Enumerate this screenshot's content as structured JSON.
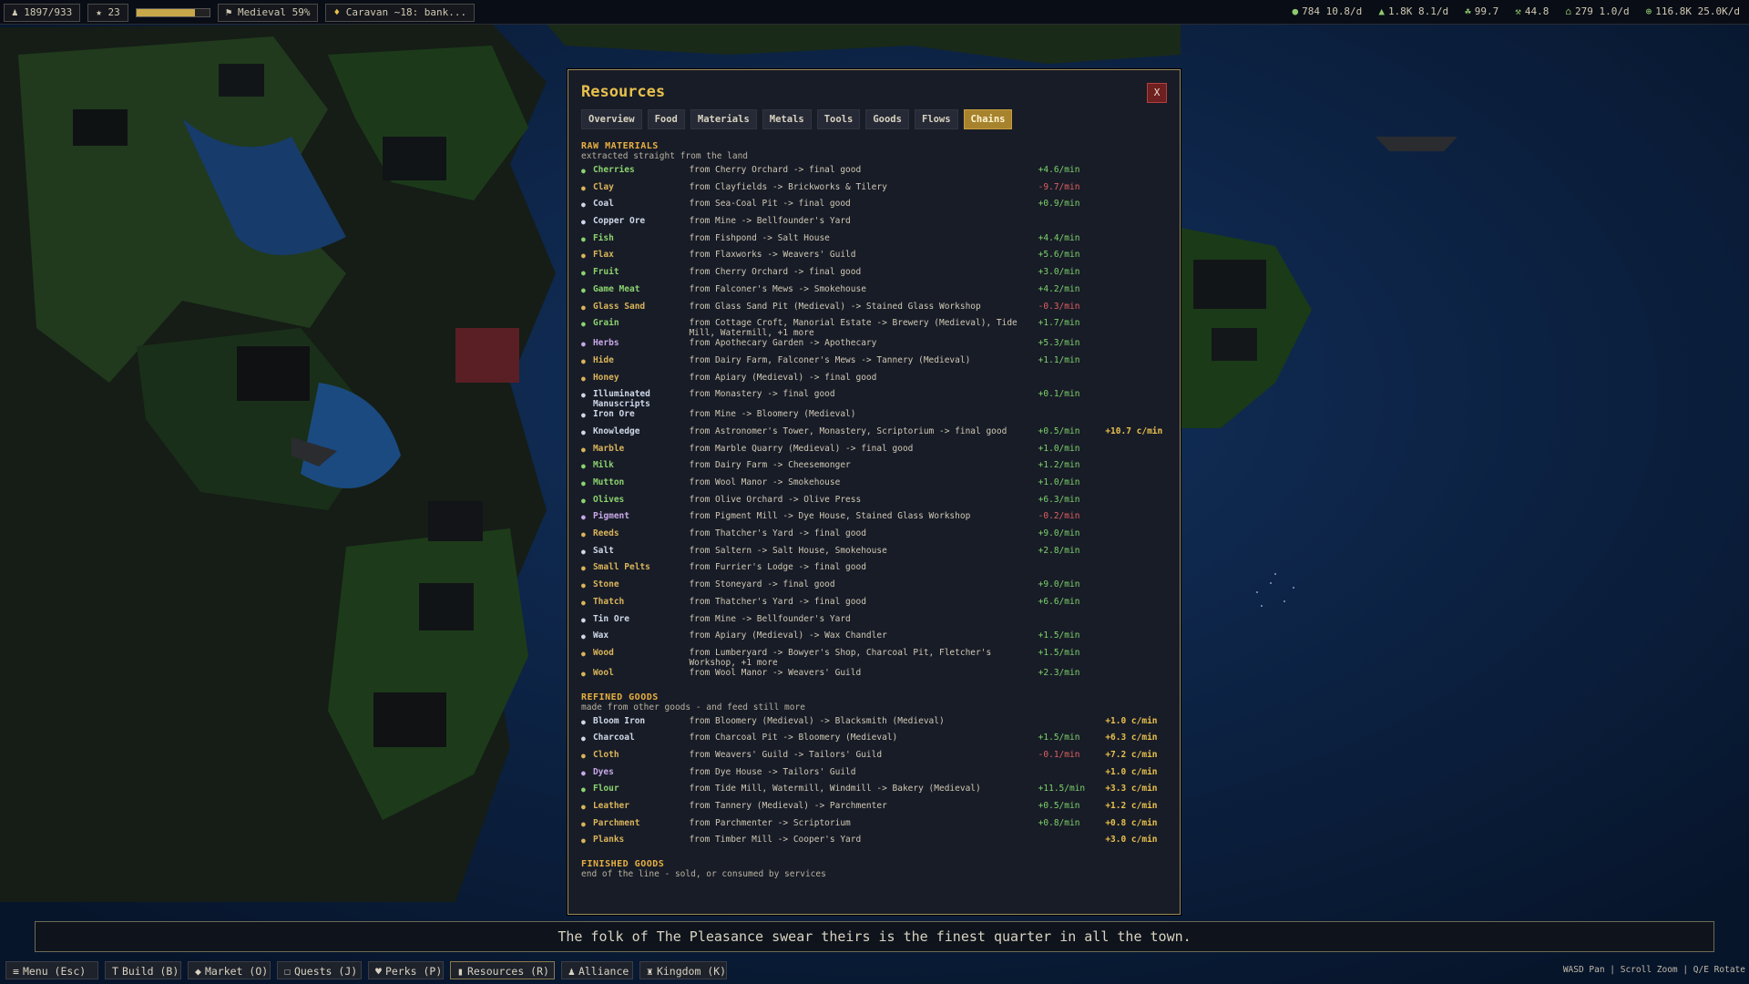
{
  "hud": {
    "population": "1897/933",
    "stars": "23",
    "era_progress": 0.8,
    "era": "Medieval 59%",
    "caravan": "Caravan ~18: bank...",
    "stats": [
      {
        "icon": "●",
        "value": "784 10.8/d"
      },
      {
        "icon": "▲",
        "value": "1.8K 8.1/d"
      },
      {
        "icon": "☘",
        "value": "99.7"
      },
      {
        "icon": "⚒",
        "value": "44.8"
      },
      {
        "icon": "⌂",
        "value": "279 1.0/d"
      },
      {
        "icon": "⊕",
        "value": "116.8K 25.0K/d"
      }
    ]
  },
  "panel": {
    "title": "Resources",
    "close_label": "X",
    "tabs": [
      "Overview",
      "Food",
      "Materials",
      "Metals",
      "Tools",
      "Goods",
      "Flows",
      "Chains"
    ],
    "active_tab": 7,
    "sections": {
      "raw": {
        "title": "RAW MATERIALS",
        "subtitle": "extracted straight from the land",
        "items": [
          {
            "icon": "●",
            "cls": "g",
            "name": "Cherries",
            "src": "from Cherry Orchard   -> final good",
            "rate": "+4.6/min",
            "rcls": "pos",
            "cmin": ""
          },
          {
            "icon": "●",
            "cls": "y",
            "name": "Clay",
            "src": "from Clayfields   -> Brickworks & Tilery",
            "rate": "-9.7/min",
            "rcls": "neg",
            "cmin": ""
          },
          {
            "icon": "●",
            "cls": "w",
            "name": "Coal",
            "src": "from Sea-Coal Pit   -> final good",
            "rate": "+0.9/min",
            "rcls": "pos",
            "cmin": ""
          },
          {
            "icon": "●",
            "cls": "w",
            "name": "Copper Ore",
            "src": "from Mine   -> Bellfounder's Yard",
            "rate": "",
            "rcls": "pos",
            "cmin": ""
          },
          {
            "icon": "●",
            "cls": "g",
            "name": "Fish",
            "src": "from Fishpond   -> Salt House",
            "rate": "+4.4/min",
            "rcls": "pos",
            "cmin": ""
          },
          {
            "icon": "●",
            "cls": "y",
            "name": "Flax",
            "src": "from Flaxworks   -> Weavers' Guild",
            "rate": "+5.6/min",
            "rcls": "pos",
            "cmin": ""
          },
          {
            "icon": "●",
            "cls": "g",
            "name": "Fruit",
            "src": "from Cherry Orchard   -> final good",
            "rate": "+3.0/min",
            "rcls": "pos",
            "cmin": ""
          },
          {
            "icon": "●",
            "cls": "g",
            "name": "Game Meat",
            "src": "from Falconer's Mews   -> Smokehouse",
            "rate": "+4.2/min",
            "rcls": "pos",
            "cmin": ""
          },
          {
            "icon": "●",
            "cls": "y",
            "name": "Glass Sand",
            "src": "from Glass Sand Pit (Medieval)   -> Stained Glass Workshop",
            "rate": "-0.3/min",
            "rcls": "neg",
            "cmin": ""
          },
          {
            "icon": "●",
            "cls": "g",
            "name": "Grain",
            "src": "from Cottage Croft, Manorial Estate   -> Brewery (Medieval), Tide Mill, Watermill, +1 more",
            "rate": "+1.7/min",
            "rcls": "pos",
            "cmin": ""
          },
          {
            "icon": "●",
            "cls": "p",
            "name": "Herbs",
            "src": "from Apothecary Garden   -> Apothecary",
            "rate": "+5.3/min",
            "rcls": "pos",
            "cmin": ""
          },
          {
            "icon": "●",
            "cls": "y",
            "name": "Hide",
            "src": "from Dairy Farm, Falconer's Mews   -> Tannery (Medieval)",
            "rate": "+1.1/min",
            "rcls": "pos",
            "cmin": ""
          },
          {
            "icon": "●",
            "cls": "y",
            "name": "Honey",
            "src": "from Apiary (Medieval)   -> final good",
            "rate": "",
            "rcls": "pos",
            "cmin": ""
          },
          {
            "icon": "●",
            "cls": "w",
            "name": "Illuminated Manuscripts",
            "src": "from Monastery   -> final good",
            "rate": "+0.1/min",
            "rcls": "pos",
            "cmin": ""
          },
          {
            "icon": "●",
            "cls": "w",
            "name": "Iron Ore",
            "src": "from Mine   -> Bloomery (Medieval)",
            "rate": "",
            "rcls": "pos",
            "cmin": ""
          },
          {
            "icon": "●",
            "cls": "w",
            "name": "Knowledge",
            "src": "from Astronomer's Tower, Monastery, Scriptorium   -> final good",
            "rate": "+0.5/min",
            "rcls": "pos",
            "cmin": "+10.7 c/min"
          },
          {
            "icon": "●",
            "cls": "y",
            "name": "Marble",
            "src": "from Marble Quarry (Medieval)   -> final good",
            "rate": "+1.0/min",
            "rcls": "pos",
            "cmin": ""
          },
          {
            "icon": "●",
            "cls": "g",
            "name": "Milk",
            "src": "from Dairy Farm   -> Cheesemonger",
            "rate": "+1.2/min",
            "rcls": "pos",
            "cmin": ""
          },
          {
            "icon": "●",
            "cls": "g",
            "name": "Mutton",
            "src": "from Wool Manor   -> Smokehouse",
            "rate": "+1.0/min",
            "rcls": "pos",
            "cmin": ""
          },
          {
            "icon": "●",
            "cls": "g",
            "name": "Olives",
            "src": "from Olive Orchard   -> Olive Press",
            "rate": "+6.3/min",
            "rcls": "pos",
            "cmin": ""
          },
          {
            "icon": "●",
            "cls": "p",
            "name": "Pigment",
            "src": "from Pigment Mill   -> Dye House, Stained Glass Workshop",
            "rate": "-0.2/min",
            "rcls": "neg",
            "cmin": ""
          },
          {
            "icon": "●",
            "cls": "y",
            "name": "Reeds",
            "src": "from Thatcher's Yard   -> final good",
            "rate": "+9.0/min",
            "rcls": "pos",
            "cmin": ""
          },
          {
            "icon": "●",
            "cls": "w",
            "name": "Salt",
            "src": "from Saltern   -> Salt House, Smokehouse",
            "rate": "+2.8/min",
            "rcls": "pos",
            "cmin": ""
          },
          {
            "icon": "●",
            "cls": "y",
            "name": "Small Pelts",
            "src": "from Furrier's Lodge   -> final good",
            "rate": "",
            "rcls": "pos",
            "cmin": ""
          },
          {
            "icon": "●",
            "cls": "y",
            "name": "Stone",
            "src": "from Stoneyard   -> final good",
            "rate": "+9.0/min",
            "rcls": "pos",
            "cmin": ""
          },
          {
            "icon": "●",
            "cls": "y",
            "name": "Thatch",
            "src": "from Thatcher's Yard   -> final good",
            "rate": "+6.6/min",
            "rcls": "pos",
            "cmin": ""
          },
          {
            "icon": "●",
            "cls": "w",
            "name": "Tin Ore",
            "src": "from Mine   -> Bellfounder's Yard",
            "rate": "",
            "rcls": "pos",
            "cmin": ""
          },
          {
            "icon": "●",
            "cls": "w",
            "name": "Wax",
            "src": "from Apiary (Medieval)   -> Wax Chandler",
            "rate": "+1.5/min",
            "rcls": "pos",
            "cmin": ""
          },
          {
            "icon": "●",
            "cls": "y",
            "name": "Wood",
            "src": "from Lumberyard   -> Bowyer's Shop, Charcoal Pit, Fletcher's Workshop, +1 more",
            "rate": "+1.5/min",
            "rcls": "pos",
            "cmin": ""
          },
          {
            "icon": "●",
            "cls": "y",
            "name": "Wool",
            "src": "from Wool Manor   -> Weavers' Guild",
            "rate": "+2.3/min",
            "rcls": "pos",
            "cmin": ""
          }
        ]
      },
      "refined": {
        "title": "REFINED GOODS",
        "subtitle": "made from other goods - and feed still more",
        "items": [
          {
            "icon": "●",
            "cls": "w",
            "name": "Bloom Iron",
            "src": "from Bloomery (Medieval)   -> Blacksmith (Medieval)",
            "rate": "",
            "rcls": "pos",
            "cmin": "+1.0 c/min"
          },
          {
            "icon": "●",
            "cls": "w",
            "name": "Charcoal",
            "src": "from Charcoal Pit   -> Bloomery (Medieval)",
            "rate": "+1.5/min",
            "rcls": "pos",
            "cmin": "+6.3 c/min"
          },
          {
            "icon": "●",
            "cls": "y",
            "name": "Cloth",
            "src": "from Weavers' Guild   -> Tailors' Guild",
            "rate": "-0.1/min",
            "rcls": "neg",
            "cmin": "+7.2 c/min"
          },
          {
            "icon": "●",
            "cls": "p",
            "name": "Dyes",
            "src": "from Dye House   -> Tailors' Guild",
            "rate": "",
            "rcls": "pos",
            "cmin": "+1.0 c/min"
          },
          {
            "icon": "●",
            "cls": "g",
            "name": "Flour",
            "src": "from Tide Mill, Watermill, Windmill   -> Bakery (Medieval)",
            "rate": "+11.5/min",
            "rcls": "pos",
            "cmin": "+3.3 c/min"
          },
          {
            "icon": "●",
            "cls": "y",
            "name": "Leather",
            "src": "from Tannery (Medieval)   -> Parchmenter",
            "rate": "+0.5/min",
            "rcls": "pos",
            "cmin": "+1.2 c/min"
          },
          {
            "icon": "●",
            "cls": "y",
            "name": "Parchment",
            "src": "from Parchmenter   -> Scriptorium",
            "rate": "+0.8/min",
            "rcls": "pos",
            "cmin": "+0.8 c/min"
          },
          {
            "icon": "●",
            "cls": "y",
            "name": "Planks",
            "src": "from Timber Mill   -> Cooper's Yard",
            "rate": "",
            "rcls": "pos",
            "cmin": "+3.0 c/min"
          }
        ]
      },
      "finished": {
        "title": "FINISHED GOODS",
        "subtitle": "end of the line - sold, or consumed by services",
        "items": []
      }
    }
  },
  "message": "The folk of The Pleasance swear theirs is the finest quarter in all the town.",
  "bottom": {
    "buttons": [
      {
        "icon": "≡",
        "label": "Menu (Esc)",
        "name": "menu-button"
      },
      {
        "icon": "T",
        "label": "Build (B)",
        "name": "build-button"
      },
      {
        "icon": "◆",
        "label": "Market (O)",
        "name": "market-button"
      },
      {
        "icon": "☐",
        "label": "Quests (J)",
        "name": "quests-button"
      },
      {
        "icon": "♥",
        "label": "Perks (P)",
        "name": "perks-button"
      },
      {
        "icon": "▮",
        "label": "Resources (R)",
        "name": "resources-button"
      },
      {
        "icon": "♟",
        "label": "Alliance",
        "name": "alliance-button"
      },
      {
        "icon": "♜",
        "label": "Kingdom (K)",
        "name": "kingdom-button"
      }
    ],
    "hint": "WASD Pan | Scroll Zoom | Q/E Rotate"
  }
}
